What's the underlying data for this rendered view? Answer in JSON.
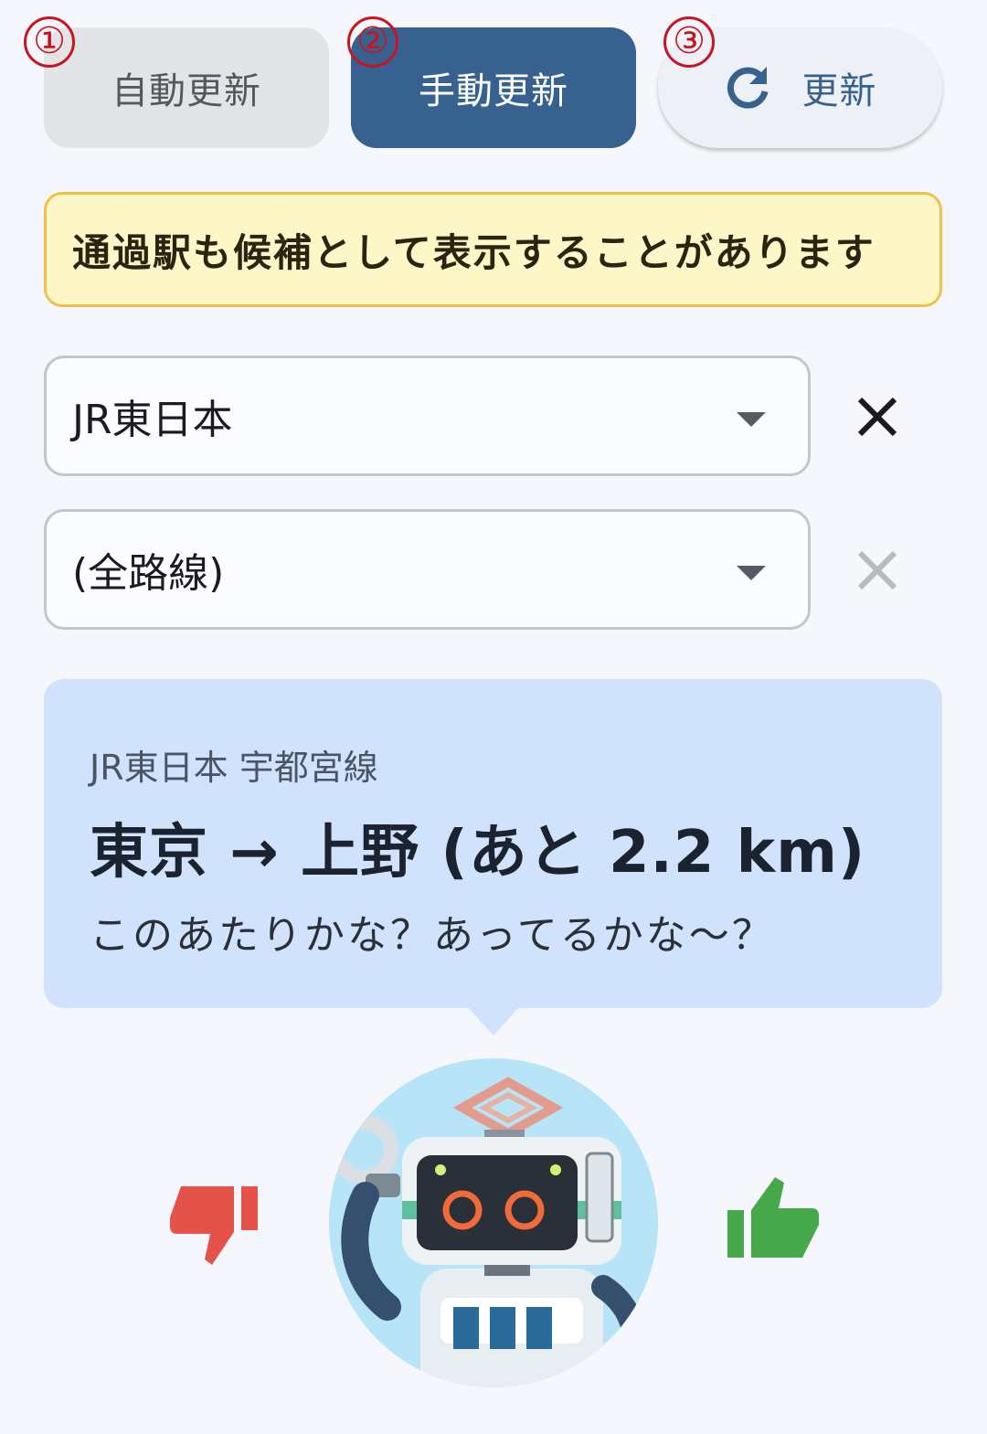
{
  "mode_buttons": {
    "auto_label": "自動更新",
    "manual_label": "手動更新",
    "refresh_label": "更新"
  },
  "markers": [
    "①",
    "②",
    "③"
  ],
  "notice": {
    "text": "通過駅も候補として表示することがあります"
  },
  "filters": {
    "company_value": "JR東日本",
    "line_value": "(全路線)"
  },
  "card": {
    "line_label": "JR東日本 宇都宮線",
    "route": "東京 → 上野 (あと 2.2 km)",
    "message": "このあたりかな？あってるかな～？"
  },
  "colors": {
    "manual_active": "#37618f",
    "notice_bg": "#fdf7c8",
    "notice_border": "#eec24a",
    "card_bg": "#d1e3fc",
    "thumb_down": "#e5524a",
    "thumb_up": "#45a94b"
  },
  "icons": {
    "refresh": "refresh-icon",
    "clear": "close-icon",
    "dropdown": "chevron-down-icon",
    "thumbs_down": "thumbs-down-icon",
    "thumbs_up": "thumbs-up-icon"
  }
}
